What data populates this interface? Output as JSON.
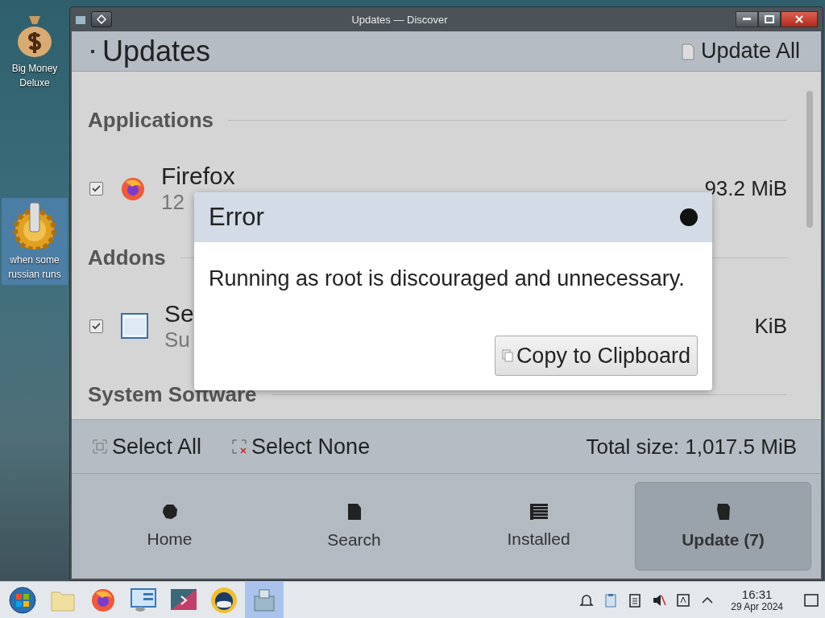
{
  "desktop_icons": [
    {
      "label": "Big Money Deluxe",
      "kind": "moneybag",
      "selected": false
    },
    {
      "label": "when some russian runs",
      "kind": "gear",
      "selected": true
    }
  ],
  "window": {
    "title": "Updates — Discover"
  },
  "header": {
    "title": "Updates",
    "action": "Update All"
  },
  "sections": [
    {
      "title": "Applications",
      "items": [
        {
          "name": "Firefox",
          "description": "12",
          "size": "93.2 MiB",
          "checked": true,
          "kind": "browser"
        }
      ]
    },
    {
      "title": "Addons",
      "items": [
        {
          "name": "Se",
          "description": "Su",
          "size": "KiB",
          "checked": true,
          "kind": "window"
        }
      ]
    },
    {
      "title": "System Software"
    }
  ],
  "footer": {
    "select_all": "Select All",
    "select_none": "Select None",
    "total": "Total size: 1,017.5 MiB"
  },
  "nav": [
    {
      "label": "Home",
      "kind": "home",
      "selected": false
    },
    {
      "label": "Search",
      "kind": "search",
      "selected": false
    },
    {
      "label": "Installed",
      "kind": "installed",
      "selected": false
    },
    {
      "label": "Update (7)",
      "kind": "update",
      "selected": true
    }
  ],
  "dialog": {
    "title": "Error",
    "message": "Running as root is discouraged and unnecessary.",
    "button": "Copy to Clipboard"
  },
  "taskbar": {
    "apps": [
      {
        "kind": "start",
        "selected": false
      },
      {
        "kind": "folder",
        "selected": false
      },
      {
        "kind": "browser",
        "selected": false
      },
      {
        "kind": "monitor",
        "selected": false
      },
      {
        "kind": "media",
        "selected": false
      },
      {
        "kind": "globe",
        "selected": false
      },
      {
        "kind": "package",
        "selected": true
      }
    ],
    "tray": [
      {
        "kind": "bell"
      },
      {
        "kind": "clipboard"
      },
      {
        "kind": "notes"
      },
      {
        "kind": "muted"
      },
      {
        "kind": "input"
      },
      {
        "kind": "arrow"
      }
    ],
    "time": "16:31",
    "date": "29 Apr 2024"
  }
}
